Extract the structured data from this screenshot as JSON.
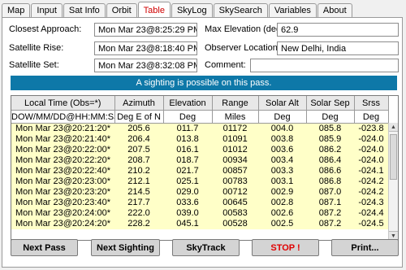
{
  "tabs": [
    "Map",
    "Input",
    "Sat Info",
    "Orbit",
    "Table",
    "SkyLog",
    "SkySearch",
    "Variables",
    "About"
  ],
  "form": {
    "closest_label": "Closest Approach:",
    "closest_value": "Mon Mar 23@8:25:29 PM",
    "rise_label": "Satellite Rise:",
    "rise_value": "Mon Mar 23@8:18:40 PM",
    "set_label": "Satellite Set:",
    "set_value": "Mon Mar 23@8:32:08 PM",
    "maxel_label": "Max Elevation (deg):",
    "maxel_value": "62.9",
    "observer_label": "Observer Location:",
    "observer_value": "New Delhi, India",
    "comment_label": "Comment:",
    "comment_value": ""
  },
  "banner": "A sighting is possible on this pass.",
  "table": {
    "headers": [
      "Local Time (Obs=*)",
      "Azimuth",
      "Elevation",
      "Range",
      "Solar Alt",
      "Solar Sep",
      "Srss"
    ],
    "units": [
      "DOW/MM/DD@HH:MM:SS",
      "Deg E of N",
      "Deg",
      "Miles",
      "Deg",
      "Deg",
      "Deg"
    ],
    "rows": [
      [
        "Mon Mar 23@20:21:20*",
        "205.6",
        "011.7",
        "01172",
        "004.0",
        "085.8",
        "-023.8"
      ],
      [
        "Mon Mar 23@20:21:40*",
        "206.4",
        "013.8",
        "01091",
        "003.8",
        "085.9",
        "-024.0"
      ],
      [
        "Mon Mar 23@20:22:00*",
        "207.5",
        "016.1",
        "01012",
        "003.6",
        "086.2",
        "-024.0"
      ],
      [
        "Mon Mar 23@20:22:20*",
        "208.7",
        "018.7",
        "00934",
        "003.4",
        "086.4",
        "-024.0"
      ],
      [
        "Mon Mar 23@20:22:40*",
        "210.2",
        "021.7",
        "00857",
        "003.3",
        "086.6",
        "-024.1"
      ],
      [
        "Mon Mar 23@20:23:00*",
        "212.1",
        "025.1",
        "00783",
        "003.1",
        "086.8",
        "-024.2"
      ],
      [
        "Mon Mar 23@20:23:20*",
        "214.5",
        "029.0",
        "00712",
        "002.9",
        "087.0",
        "-024.2"
      ],
      [
        "Mon Mar 23@20:23:40*",
        "217.7",
        "033.6",
        "00645",
        "002.8",
        "087.1",
        "-024.3"
      ],
      [
        "Mon Mar 23@20:24:00*",
        "222.0",
        "039.0",
        "00583",
        "002.6",
        "087.2",
        "-024.4"
      ],
      [
        "Mon Mar 23@20:24:20*",
        "228.2",
        "045.1",
        "00528",
        "002.5",
        "087.2",
        "-024.5"
      ]
    ]
  },
  "buttons": {
    "next_pass": "Next Pass",
    "next_sighting": "Next Sighting",
    "skytrack": "SkyTrack",
    "stop": "STOP !",
    "print": "Print..."
  },
  "colors": {
    "banner": "#0e78a8",
    "row_bg": "#ffffc8",
    "active_tab": "#d00000",
    "stop": "#e00000"
  }
}
